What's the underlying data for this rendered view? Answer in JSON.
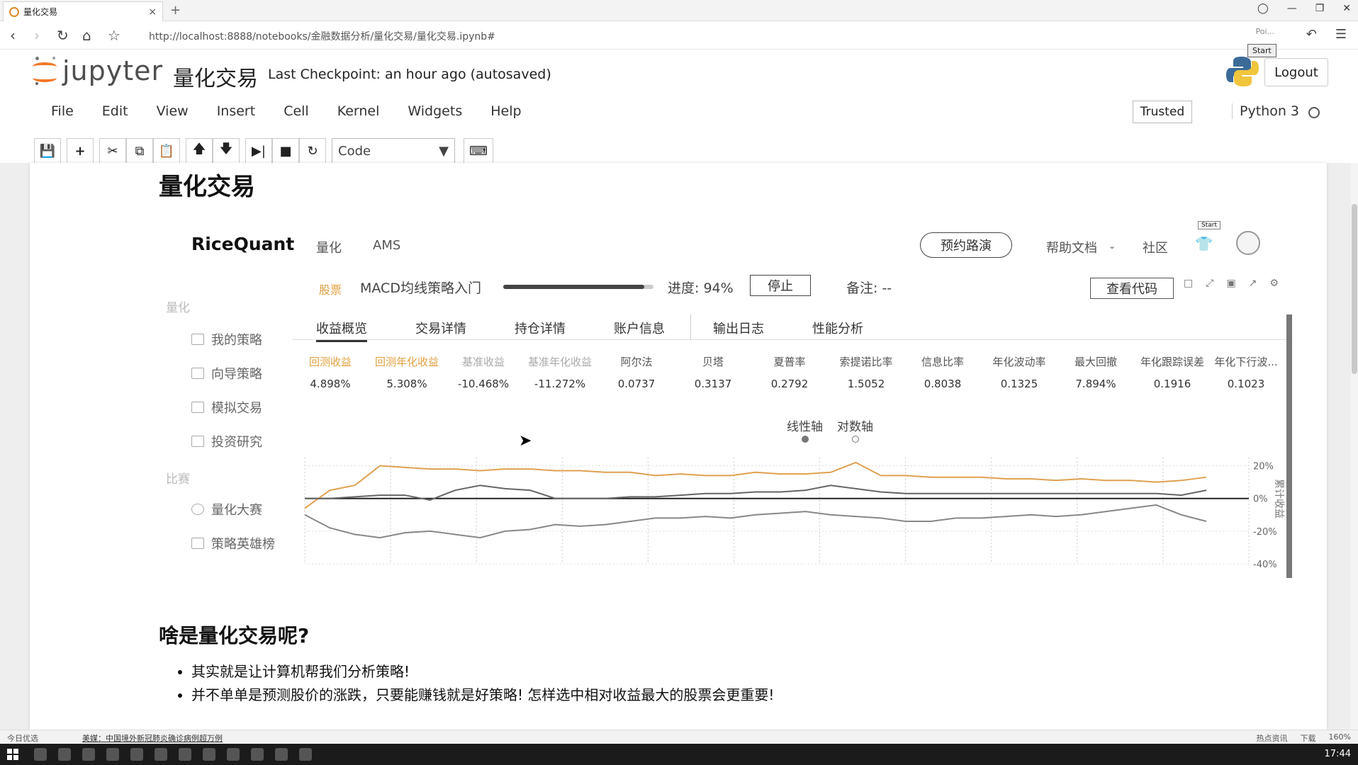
{
  "browser": {
    "tab_title": "量化交易",
    "tab_close": "×",
    "new_tab": "+",
    "url": "http://localhost:8888/notebooks/金融数据分析/量化交易/量化交易.ipynb#",
    "poi_text": "Poi..."
  },
  "jupyter": {
    "logo_text": "jupyter",
    "notebook_name": "量化交易",
    "checkpoint": "Last Checkpoint: an hour ago (autosaved)",
    "logout": "Logout",
    "start_tip": "Start",
    "menus": [
      "File",
      "Edit",
      "View",
      "Insert",
      "Cell",
      "Kernel",
      "Widgets",
      "Help"
    ],
    "trusted": "Trusted",
    "kernel": "Python 3",
    "cell_type": "Code"
  },
  "ricequant": {
    "logo": "RiceQuant",
    "nav": [
      "量化",
      "AMS"
    ],
    "demo_btn": "预约路演",
    "help_docs": "帮助文档",
    "community": "社区",
    "start_tip": "Start",
    "sidebar": {
      "section1": "量化",
      "items1": [
        "我的策略",
        "向导策略",
        "模拟交易",
        "投资研究"
      ],
      "section2": "比赛",
      "items2": [
        "量化大赛",
        "策略英雄榜"
      ]
    },
    "strategy": {
      "tag": "股票",
      "name": "MACD均线策略入门",
      "progress_label": "进度: 94%",
      "progress": 0.94,
      "stop": "停止",
      "note": "备注: --",
      "view_code": "查看代码"
    },
    "tabs": [
      "收益概览",
      "交易详情",
      "持仓详情",
      "账户信息",
      "输出日志",
      "性能分析"
    ],
    "metrics": [
      {
        "label": "回测收益",
        "value": "4.898%"
      },
      {
        "label": "回测年化收益",
        "value": "5.308%"
      },
      {
        "label": "基准收益",
        "value": "-10.468%"
      },
      {
        "label": "基准年化收益",
        "value": "-11.272%"
      },
      {
        "label": "阿尔法",
        "value": "0.0737"
      },
      {
        "label": "贝塔",
        "value": "0.3137"
      },
      {
        "label": "夏普率",
        "value": "0.2792"
      },
      {
        "label": "索提诺比率",
        "value": "1.5052"
      },
      {
        "label": "信息比率",
        "value": "0.8038"
      },
      {
        "label": "年化波动率",
        "value": "0.1325"
      },
      {
        "label": "最大回撤",
        "value": "7.894%"
      },
      {
        "label": "年化跟踪误差",
        "value": "0.1916"
      },
      {
        "label": "年化下行波...",
        "value": "0.1023"
      }
    ],
    "axis_linear": "线性轴",
    "axis_log": "对数轴"
  },
  "chart_data": {
    "type": "line",
    "ylabel": "累计收益",
    "yticks": [
      "20%",
      "0%",
      "-20%",
      "-40%"
    ],
    "ylim": [
      -40,
      25
    ],
    "series": [
      {
        "color": "#e0a050",
        "values": [
          -6,
          5,
          8,
          20,
          19,
          18,
          18,
          17,
          18,
          18,
          17,
          17,
          16,
          16,
          14,
          15,
          14,
          14,
          16,
          15,
          15,
          16,
          22,
          14,
          14,
          13,
          13,
          13,
          12,
          12,
          11,
          12,
          11,
          11,
          10,
          11,
          13
        ]
      },
      {
        "color": "#666666",
        "values": [
          0,
          0,
          1,
          2,
          2,
          -1,
          5,
          8,
          6,
          5,
          0,
          0,
          0,
          1,
          1,
          2,
          3,
          3,
          4,
          4,
          5,
          8,
          6,
          4,
          3,
          3,
          3,
          3,
          3,
          3,
          3,
          3,
          3,
          3,
          3,
          2,
          5
        ]
      },
      {
        "color": "#888888",
        "values": [
          -10,
          -18,
          -22,
          -24,
          -21,
          -20,
          -22,
          -24,
          -20,
          -19,
          -16,
          -17,
          -16,
          -14,
          -12,
          -12,
          -11,
          -12,
          -10,
          -9,
          -8,
          -10,
          -11,
          -12,
          -14,
          -14,
          -12,
          -12,
          -11,
          -10,
          -11,
          -10,
          -8,
          -6,
          -4,
          -10,
          -14
        ]
      }
    ]
  },
  "markdown": {
    "h1": "量化交易",
    "h2": "啥是量化交易呢?",
    "bullets": [
      "其实就是让计算机帮我们分析策略!",
      "并不单单是预测股价的涨跌，只要能赚钱就是好策略! 怎样选中相对收益最大的股票会更重要!"
    ]
  },
  "statusbar": {
    "left": "今日优选",
    "news": "美媒：中国境外新冠肺炎确诊病例超万例",
    "hot": "热点资讯",
    "download": "下载",
    "zoom": "160%"
  },
  "taskbar": {
    "clock": "17:44"
  }
}
